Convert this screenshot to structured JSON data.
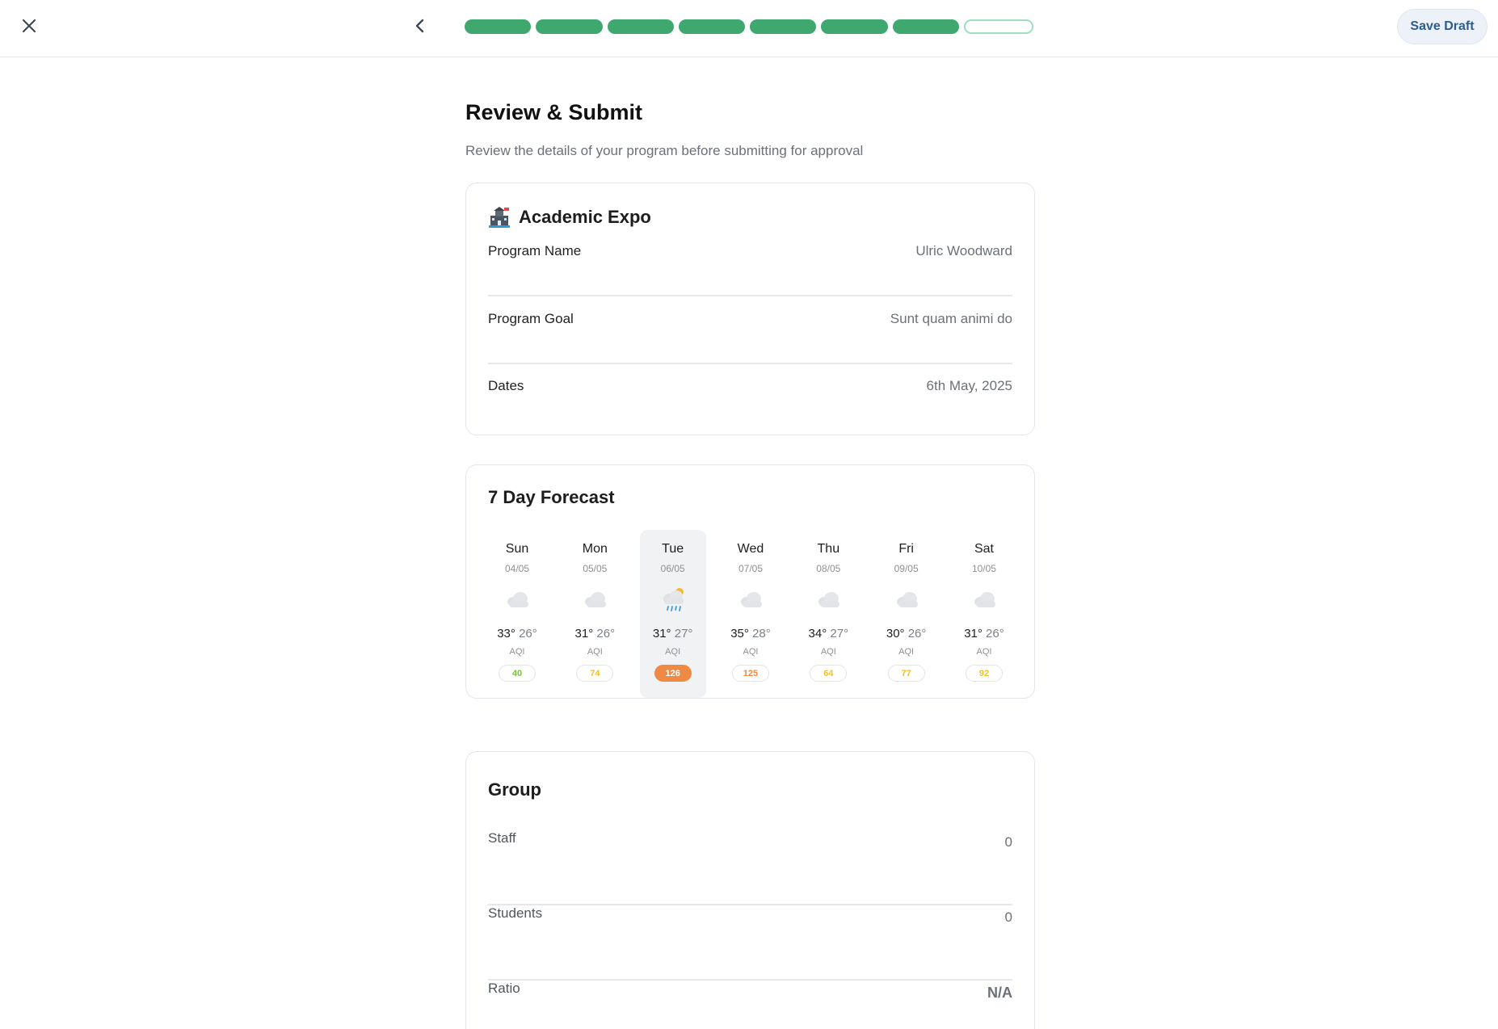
{
  "header": {
    "close_icon": "close-icon",
    "back_icon": "chevron-left-icon",
    "progress": {
      "total_steps": 8,
      "completed_steps": 7,
      "complete_color": "#3fa86e",
      "pending_border_color": "#9edfc0"
    },
    "save_draft_label": "Save Draft"
  },
  "page": {
    "title": "Review & Submit",
    "subtitle": "Review the details of your program before submitting for approval"
  },
  "program": {
    "icon": "school-building-icon",
    "title": "Academic Expo",
    "rows": [
      {
        "label": "Program Name",
        "value": "Ulric Woodward"
      },
      {
        "label": "Program Goal",
        "value": "Sunt quam animi do"
      },
      {
        "label": "Dates",
        "value": "6th May, 2025"
      }
    ]
  },
  "forecast": {
    "title": "7 Day Forecast",
    "aqi_label": "AQI",
    "days": [
      {
        "day": "Sun",
        "date": "04/05",
        "icon": "cloud-icon",
        "high": "33°",
        "low": "26°",
        "aqi": "40",
        "aqi_color": "#7cc23a",
        "selected": false
      },
      {
        "day": "Mon",
        "date": "05/05",
        "icon": "cloud-icon",
        "high": "31°",
        "low": "26°",
        "aqi": "74",
        "aqi_color": "#f0c02c",
        "selected": false
      },
      {
        "day": "Tue",
        "date": "06/05",
        "icon": "rain-cloud-sun-icon",
        "high": "31°",
        "low": "27°",
        "aqi": "126",
        "aqi_color": "#ef8a44",
        "selected": true
      },
      {
        "day": "Wed",
        "date": "07/05",
        "icon": "cloud-icon",
        "high": "35°",
        "low": "28°",
        "aqi": "125",
        "aqi_color": "#ef8a44",
        "selected": false
      },
      {
        "day": "Thu",
        "date": "08/05",
        "icon": "cloud-icon",
        "high": "34°",
        "low": "27°",
        "aqi": "64",
        "aqi_color": "#f0c02c",
        "selected": false
      },
      {
        "day": "Fri",
        "date": "09/05",
        "icon": "cloud-icon",
        "high": "30°",
        "low": "26°",
        "aqi": "77",
        "aqi_color": "#f0c02c",
        "selected": false
      },
      {
        "day": "Sat",
        "date": "10/05",
        "icon": "cloud-icon",
        "high": "31°",
        "low": "26°",
        "aqi": "92",
        "aqi_color": "#f0c02c",
        "selected": false
      }
    ]
  },
  "group": {
    "title": "Group",
    "rows": [
      {
        "label": "Staff",
        "value": "0"
      },
      {
        "label": "Students",
        "value": "0"
      },
      {
        "label": "Ratio",
        "value": "N/A"
      }
    ]
  }
}
